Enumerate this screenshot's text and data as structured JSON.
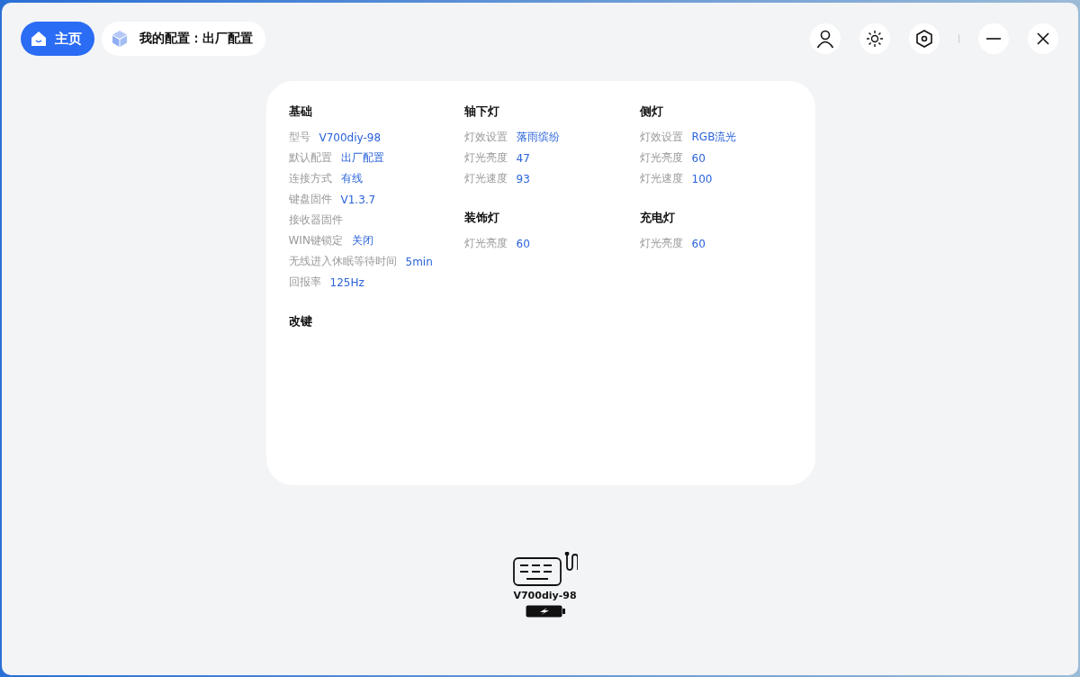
{
  "header": {
    "home_button": "主页",
    "config_chip": "我的配置：出厂配置"
  },
  "columns": [
    [
      {
        "title": "基础",
        "rows": [
          {
            "label": "型号",
            "value": "V700diy-98"
          },
          {
            "label": "默认配置",
            "value": "出厂配置"
          },
          {
            "label": "连接方式",
            "value": "有线"
          },
          {
            "label": "键盘固件",
            "value": "V1.3.7"
          },
          {
            "label": "接收器固件"
          },
          {
            "label": "WIN键锁定",
            "value": "关闭"
          },
          {
            "label": "无线进入休眠等待时间",
            "value": "5min"
          },
          {
            "label": "回报率",
            "value": "125Hz"
          }
        ]
      },
      {
        "title": "改键"
      }
    ],
    [
      {
        "title": "轴下灯",
        "rows": [
          {
            "label": "灯效设置",
            "value": "落雨缤纷"
          },
          {
            "label": "灯光亮度",
            "value": "47"
          },
          {
            "label": "灯光速度",
            "value": "93"
          }
        ]
      },
      {
        "title": "装饰灯",
        "rows": [
          {
            "label": "灯光亮度",
            "value": "60"
          }
        ]
      }
    ],
    [
      {
        "title": "侧灯",
        "rows": [
          {
            "label": "灯效设置",
            "value": "RGB流光"
          },
          {
            "label": "灯光亮度",
            "value": "60"
          },
          {
            "label": "灯光速度",
            "value": "100"
          }
        ]
      },
      {
        "title": "充电灯",
        "rows": [
          {
            "label": "灯光亮度",
            "value": "60"
          }
        ]
      }
    ]
  ],
  "device": {
    "name": "V700diy-98"
  }
}
